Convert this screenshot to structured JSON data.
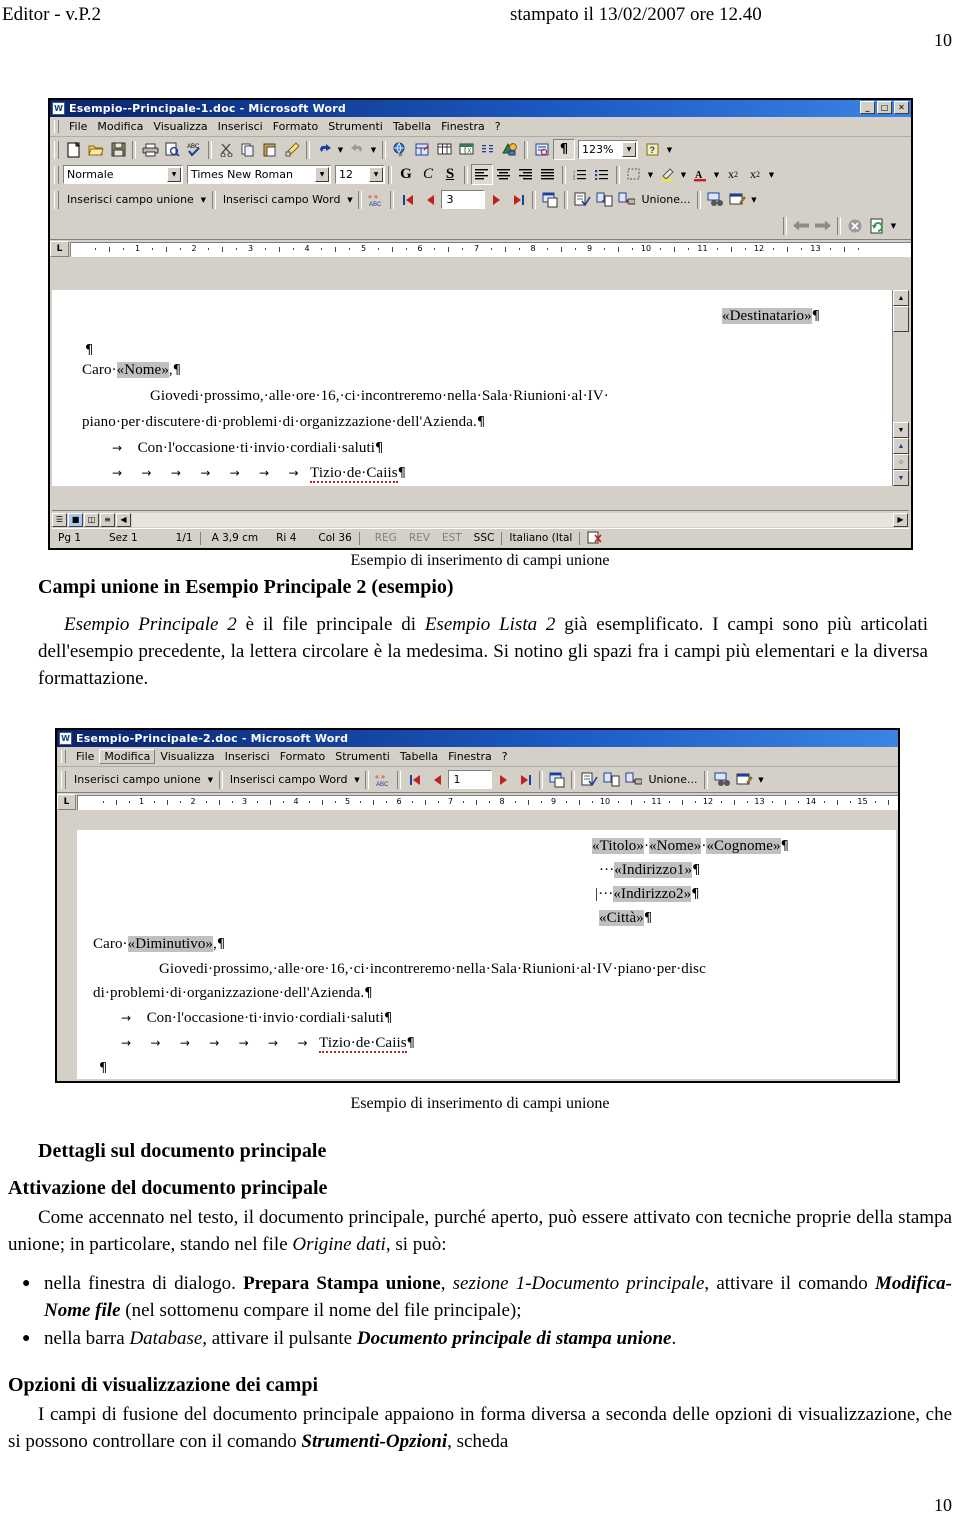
{
  "page": {
    "header_left": "Editor - v.P.2",
    "header_right": "stampato il 13/02/2007 ore 12.40",
    "page_number_top": "10",
    "page_number_bottom": "10"
  },
  "screenshot1": {
    "title": "Esempio--Principale-1.doc - Microsoft Word",
    "title_icon": "word-document-icon",
    "window_buttons": [
      "_",
      "□",
      "✕"
    ],
    "menus": [
      "File",
      "Modifica",
      "Visualizza",
      "Inserisci",
      "Formato",
      "Strumenti",
      "Tabella",
      "Finestra",
      "?"
    ],
    "standard_toolbar_icons": [
      "new-document-icon",
      "open-folder-icon",
      "save-icon",
      "print-icon",
      "print-preview-icon",
      "spellcheck-icon",
      "cut-scissors-icon",
      "copy-icon",
      "paste-icon",
      "format-painter-icon",
      "undo-icon",
      "redo-icon",
      "insert-hyperlink-icon",
      "web-toolbar-icon",
      "tables-borders-icon",
      "insert-table-icon",
      "insert-excel-sheet-icon",
      "columns-icon",
      "drawing-icon",
      "document-map-icon",
      "show-formatting-icon"
    ],
    "zoom_value": "123%",
    "help_icon": "help-icon",
    "style_value": "Normale",
    "font_value": "Times New Roman",
    "size_value": "12",
    "bold_label": "G",
    "italic_label": "C",
    "underline_label": "S",
    "align_icons": [
      "align-left-icon",
      "align-center-icon",
      "align-right-icon",
      "align-justify-icon"
    ],
    "list_icons": [
      "numbered-list-icon",
      "bulleted-list-icon"
    ],
    "format_icons": [
      "borders-icon",
      "highlight-icon",
      "font-color-icon",
      "superscript-icon",
      "subscript-icon"
    ],
    "mailmerge_toolbar": {
      "insert_merge_field": "Inserisci campo unione",
      "insert_word_field": "Inserisci campo Word",
      "view_merged_icon": "view-merged-data-abc-icon",
      "first_record_icon": "first-record-icon",
      "prev_record_icon": "prev-record-icon",
      "record_number": "3",
      "next_record_icon": "next-record-icon",
      "last_record_icon": "last-record-icon",
      "find_record_icon": "find-record-icon",
      "check_errors_icon": "check-errors-icon",
      "merge_to_document_icon": "merge-to-document-icon",
      "merge_to_printer_icon": "merge-to-printer-icon",
      "merge_label": "Unione...",
      "find_icon": "find-binoculars-icon",
      "edit_datasource_icon": "edit-data-source-icon"
    },
    "web_toolbar": {
      "back_icon": "back-arrow-icon",
      "forward_icon": "forward-arrow-icon",
      "stop_icon": "stop-icon",
      "refresh_icon": "refresh-icon"
    },
    "ruler_numbers": [
      "1",
      "2",
      "3",
      "4",
      "5",
      "6",
      "7",
      "8",
      "9",
      "10",
      "11",
      "12",
      "13"
    ],
    "ruler_tab_icon": "tab-stop-left-icon",
    "document": {
      "line_destinatario_prefix": "",
      "field_destinatario": "«Destinatario»",
      "line_caro_prefix": "Caro·",
      "field_nome": "«Nome»",
      "line_caro_suffix": ",",
      "paragraph_line1": "Giovedi·prossimo,·alle·ore·16,·ci·incontreremo·nella·Sala·Riunioni·al·IV·",
      "paragraph_line2": "piano·per·discutere·di·problemi·di·organizzazione·dell'Azienda.",
      "closing_line": "Con·l'occasione·ti·invio·cordiali·saluti",
      "signature": "Tizio·de·Caiis"
    },
    "statusbar": {
      "page": "Pg 1",
      "section": "Sez 1",
      "pages": "1/1",
      "at": "A 3,9 cm",
      "line": "Ri 4",
      "col": "Col 36",
      "rec": "REG",
      "rev": "REV",
      "est": "EST",
      "ovr": "SSC",
      "language": "Italiano (Ital",
      "spell_icon": "spellcheck-status-icon"
    },
    "view_buttons": [
      "normal-view-icon",
      "web-layout-view-icon",
      "print-layout-view-icon",
      "outline-view-icon"
    ]
  },
  "caption1": "Esempio di inserimento di campi unione",
  "section1": {
    "heading": "Campi unione in Esempio Principale 2 (esempio)",
    "para_part1_italic": "Esempio Principale 2",
    "para_part2": " è il file principale di ",
    "para_part3_italic": "Esempio Lista 2",
    "para_part4": " già esemplificato. I campi sono più articolati dell'esempio precedente, la lettera circolare è la medesima. Si notino gli spazi fra i campi più elementari e la diversa formattazione."
  },
  "screenshot2": {
    "title": "Esempio-Principale-2.doc - Microsoft Word",
    "title_icon": "word-document-icon",
    "menus": [
      "File",
      "Modifica",
      "Visualizza",
      "Inserisci",
      "Formato",
      "Strumenti",
      "Tabella",
      "Finestra",
      "?"
    ],
    "active_menu": "Modifica",
    "mailmerge_toolbar": {
      "insert_merge_field": "Inserisci campo unione",
      "insert_word_field": "Inserisci campo Word",
      "view_merged_icon": "view-merged-data-abc-icon",
      "first_record_icon": "first-record-icon",
      "prev_record_icon": "prev-record-icon",
      "record_number": "1",
      "next_record_icon": "next-record-icon",
      "last_record_icon": "last-record-icon",
      "find_record_icon": "find-record-icon",
      "check_errors_icon": "check-errors-icon",
      "merge_to_document_icon": "merge-to-document-icon",
      "merge_to_printer_icon": "merge-to-printer-icon",
      "merge_label": "Unione...",
      "find_icon": "find-binoculars-icon",
      "edit_datasource_icon": "edit-data-source-icon"
    },
    "ruler_numbers": [
      "1",
      "2",
      "3",
      "4",
      "5",
      "6",
      "7",
      "8",
      "9",
      "10",
      "11",
      "12",
      "13",
      "14",
      "15"
    ],
    "ruler_tab_icon": "tab-stop-left-icon",
    "document": {
      "field_titolo": "«Titolo»",
      "field_nome": "«Nome»",
      "field_cognome": "«Cognome»",
      "field_indirizzo1": "«Indirizzo1»",
      "field_indirizzo2": "«Indirizzo2»",
      "field_citta": "«Città»",
      "line_caro_prefix": "Caro·",
      "field_diminutivo": "«Diminutivo»",
      "line_caro_suffix": ",",
      "paragraph_line1": "Giovedi·prossimo,·alle·ore·16,·ci·incontreremo·nella·Sala·Riunioni·al·IV·piano·per·disc",
      "paragraph_line2": "di·problemi·di·organizzazione·dell'Azienda.",
      "closing_line": "Con·l'occasione·ti·invio·cordiali·saluti",
      "signature": "Tizio·de·Caiis"
    }
  },
  "caption2": "Esempio di inserimento di campi unione",
  "section2": {
    "heading_main": "Dettagli sul documento principale",
    "heading_sub": "Attivazione del documento principale",
    "para1_a": "Come accennato nel testo, il documento principale, purché aperto, può essere attivato con tecniche proprie della stampa unione; in particolare, stando nel file ",
    "para1_italic": "Origine dati",
    "para1_b": ", si può:",
    "bullets": [
      {
        "part1": "nella finestra di dialogo. ",
        "bold1": "Prepara Stampa unione",
        "part2": ", ",
        "italic1": "sezione 1-Documento principale",
        "part3": ", attivare il comando ",
        "bolditalic1": "Modifica-Nome file",
        "part4": " (nel sottomenu compare il nome del file principale);"
      },
      {
        "part1": "nella barra ",
        "italic1": "Database",
        "part2": ", attivare il pulsante ",
        "bolditalic1": "Documento principale di stampa unione",
        "part3": "."
      }
    ],
    "heading_opzioni": "Opzioni di visualizzazione dei campi",
    "para2_a": "I campi di fusione del documento principale appaiono in forma diversa a seconda delle opzioni di visualizzazione, che si possono controllare con il comando ",
    "para2_bolditalic": "Strumenti-Opzioni",
    "para2_b": ", scheda"
  },
  "colors": {
    "titlebar_start": "#0a246a",
    "titlebar_end": "#3a84e4",
    "chrome": "#d4d0c8",
    "field_highlight": "#c0c0c0",
    "text": "#000000"
  }
}
